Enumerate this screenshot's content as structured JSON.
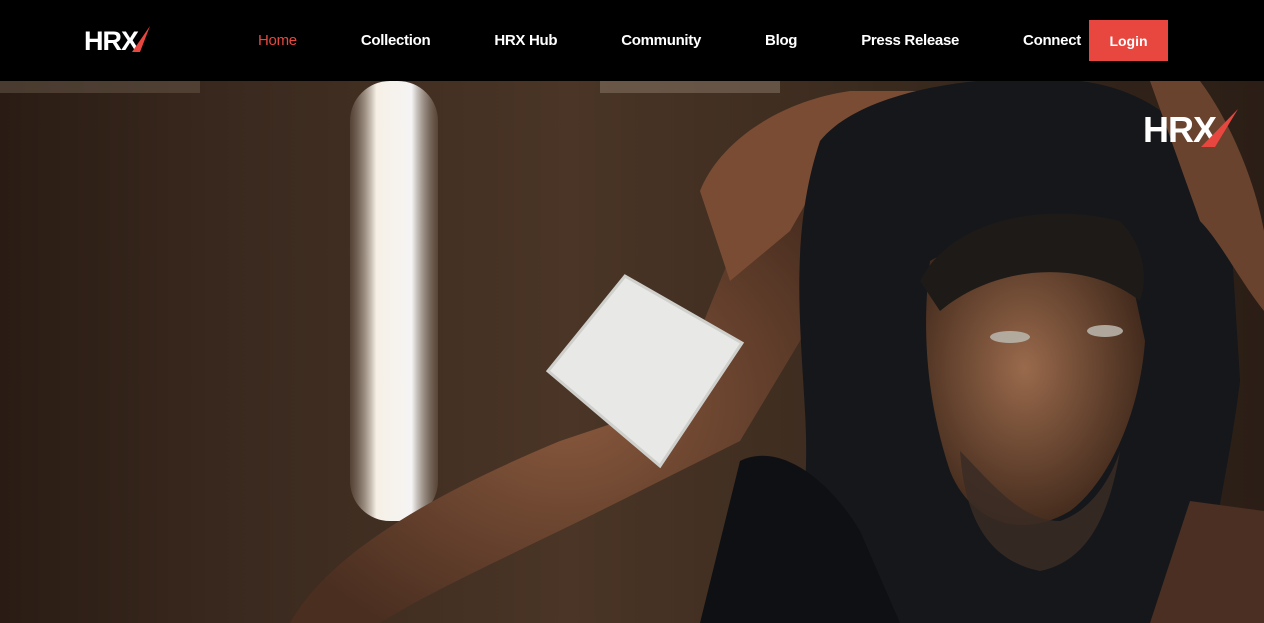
{
  "brand": {
    "logo_text": "HRX"
  },
  "nav": {
    "items": [
      {
        "label": "Home",
        "active": true
      },
      {
        "label": "Collection",
        "active": false
      },
      {
        "label": "HRX Hub",
        "active": false
      },
      {
        "label": "Community",
        "active": false
      },
      {
        "label": "Blog",
        "active": false
      },
      {
        "label": "Press Release",
        "active": false
      },
      {
        "label": "Connect",
        "active": false
      }
    ],
    "login_label": "Login"
  },
  "hero": {
    "watermark_text": "HRX"
  },
  "colors": {
    "accent": "#e8473f",
    "nav_bg": "#000000",
    "text": "#ffffff"
  }
}
